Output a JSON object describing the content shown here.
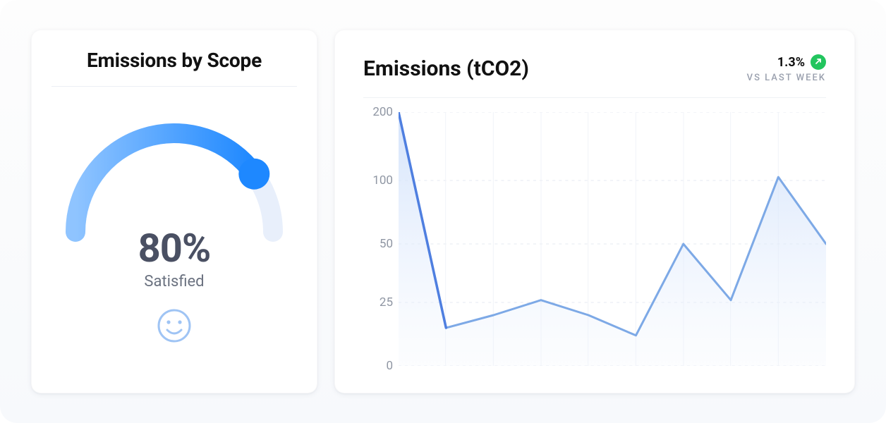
{
  "left": {
    "title": "Emissions by Scope",
    "gauge": {
      "value_text": "80%",
      "label": "Satisfied",
      "percent": 80
    }
  },
  "right": {
    "title": "Emissions (tCO2)",
    "trend": {
      "value": "1.3%",
      "caption": "VS LAST WEEK"
    },
    "y_ticks": [
      "200",
      "100",
      "50",
      "25",
      "0"
    ]
  },
  "colors": {
    "accent": "#2d8cff",
    "accent_light": "#8fbfff",
    "line": "#7fa9e8",
    "area": "#dfeafc",
    "green": "#22c55e"
  },
  "chart_data": [
    {
      "type": "gauge",
      "title": "Emissions by Scope",
      "value": 80,
      "max": 100,
      "unit": "%",
      "label": "Satisfied"
    },
    {
      "type": "area",
      "title": "Emissions (tCO2)",
      "ylabel": "",
      "xlabel": "",
      "ylim": [
        0,
        200
      ],
      "y_ticks": [
        0,
        25,
        50,
        100,
        200
      ],
      "x": [
        0,
        1,
        2,
        3,
        4,
        5,
        6,
        7,
        8
      ],
      "values": [
        200,
        15,
        20,
        26,
        20,
        12,
        50,
        26,
        105
      ],
      "values_extra_tail": 50,
      "trend": {
        "direction": "up",
        "value_pct": 1.3,
        "vs": "last week"
      }
    }
  ]
}
